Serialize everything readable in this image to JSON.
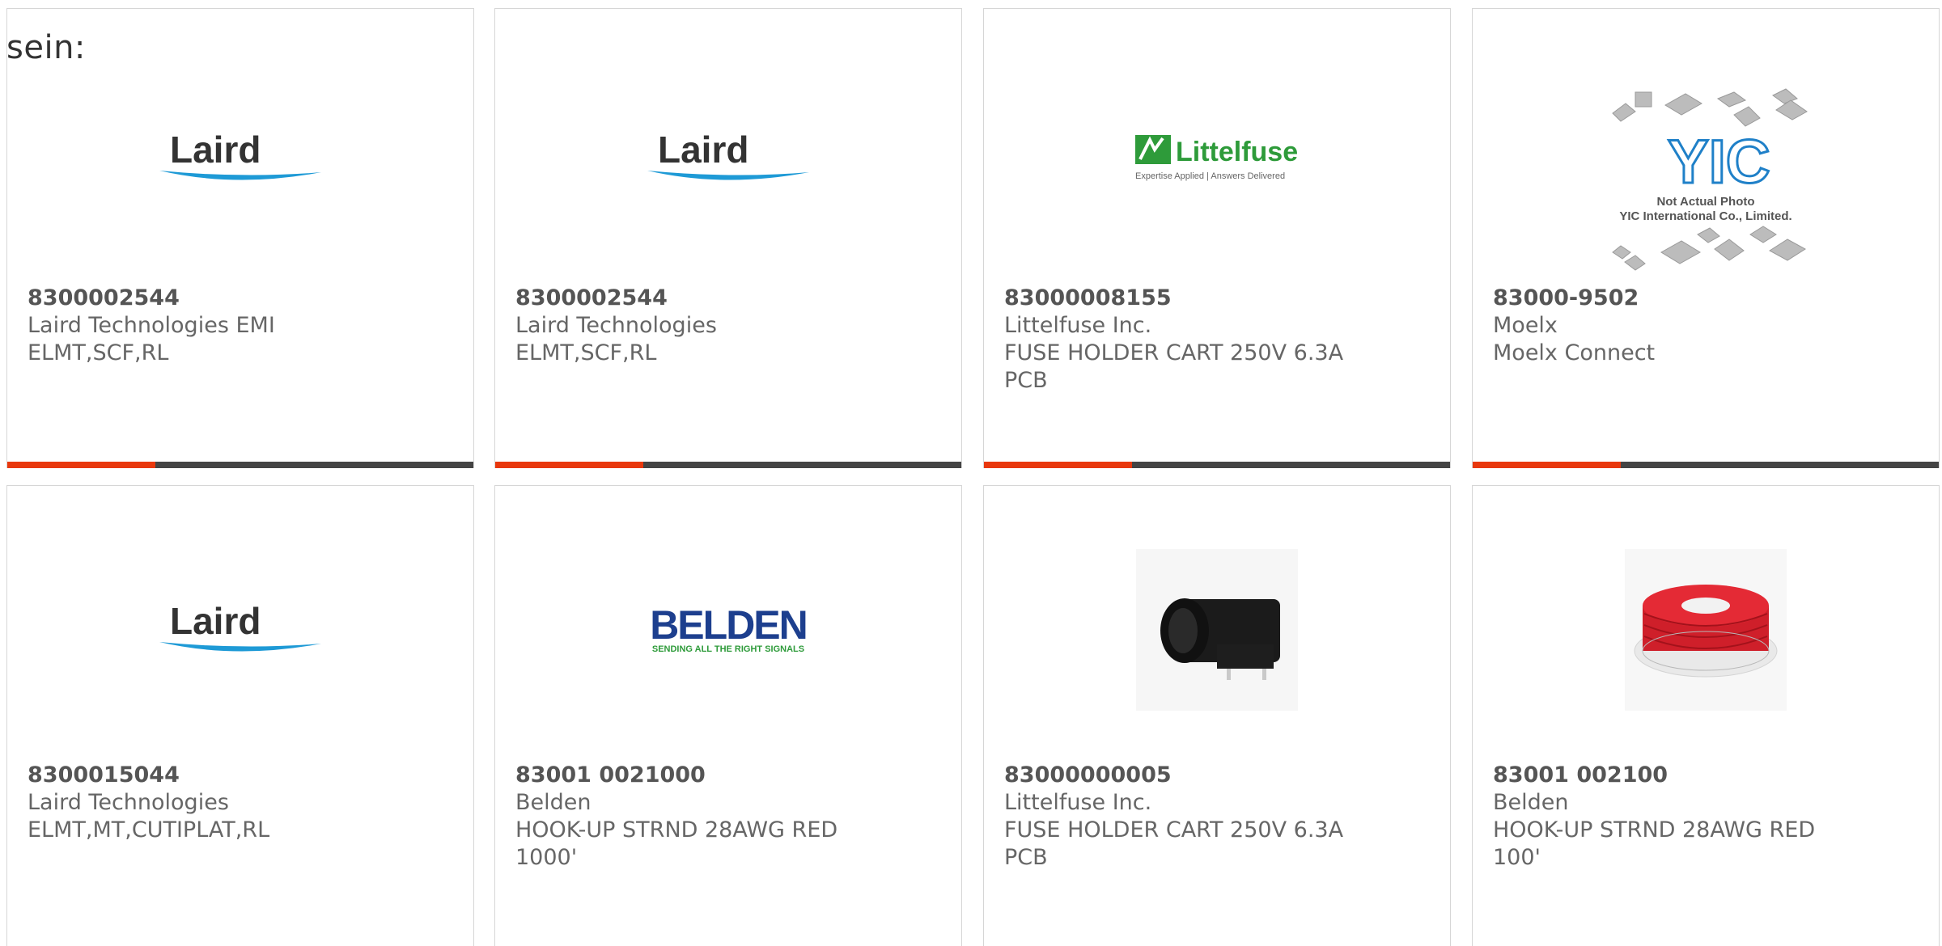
{
  "intro_text": "sein:",
  "colors": {
    "accent": "#e8380d",
    "bar": "#444444",
    "text": "#666666",
    "border": "#d6d6d6"
  },
  "cards": [
    {
      "part": "8300002544",
      "maker": "Laird Technologies EMI",
      "desc": "ELMT,SCF,RL",
      "image": "laird-logo"
    },
    {
      "part": "8300002544",
      "maker": "Laird Technologies",
      "desc": "ELMT,SCF,RL",
      "image": "laird-logo"
    },
    {
      "part": "83000008155",
      "maker": "Littelfuse Inc.",
      "desc": "FUSE HOLDER CART 250V 6.3A PCB",
      "image": "littelfuse-logo"
    },
    {
      "part": "83000-9502",
      "maker": "Moelx",
      "desc": "Moelx Connect",
      "image": "yic-placeholder"
    },
    {
      "part": "8300015044",
      "maker": "Laird Technologies",
      "desc": "ELMT,MT,CUTIPLAT,RL",
      "image": "laird-logo"
    },
    {
      "part": "83001 0021000",
      "maker": "Belden",
      "desc": "HOOK-UP STRND 28AWG RED 1000'",
      "image": "belden-logo"
    },
    {
      "part": "83000000005",
      "maker": "Littelfuse Inc.",
      "desc": "FUSE HOLDER CART 250V 6.3A PCB",
      "image": "fuse-holder-photo"
    },
    {
      "part": "83001 002100",
      "maker": "Belden",
      "desc": "HOOK-UP STRND 28AWG RED 100'",
      "image": "red-wire-spool-photo"
    }
  ],
  "logos": {
    "laird": "Laird",
    "littelfuse": "Littelfuse",
    "littelfuse_tagline": "Expertise Applied | Answers Delivered",
    "belden": "BELDEN",
    "belden_tagline": "SENDING ALL THE RIGHT SIGNALS",
    "yic_mark": "YIC",
    "yic_line1": "Not Actual Photo",
    "yic_line2": "YIC International Co., Limited."
  }
}
